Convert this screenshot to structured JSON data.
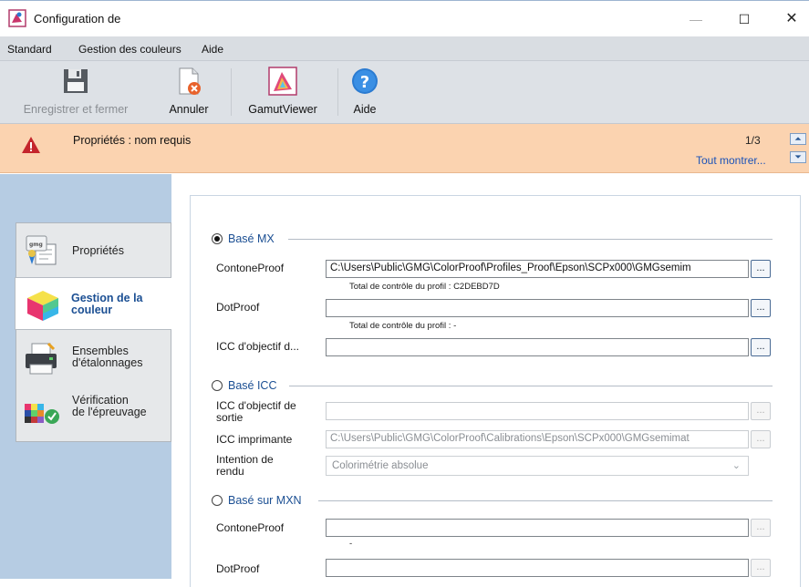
{
  "window": {
    "title": "Configuration de"
  },
  "menu": [
    "Standard",
    "Gestion des couleurs",
    "Aide"
  ],
  "toolbar": {
    "save_label": "Enregistrer et fermer",
    "cancel_label": "Annuler",
    "gamut_label": "GamutViewer",
    "help_label": "Aide"
  },
  "notification": {
    "message": "Propriétés : nom requis",
    "count": "1/3",
    "show_all": "Tout montrer..."
  },
  "nav": [
    {
      "label_l1": "Propriétés",
      "label_l2": "",
      "icon": "properties-icon"
    },
    {
      "label_l1": "Gestion de la",
      "label_l2": "couleur",
      "icon": "color-cube-icon"
    },
    {
      "label_l1": "Ensembles",
      "label_l2": "d'étalonnages",
      "icon": "printer-icon"
    },
    {
      "label_l1": "Vérification",
      "label_l2": "de l'épreuvage",
      "icon": "verification-icon"
    }
  ],
  "sections": {
    "mx": {
      "title": "Basé MX",
      "contone_label": "ContoneProof",
      "contone_value": "C:\\Users\\Public\\GMG\\ColorProof\\Profiles_Proof\\Epson\\SCPx000\\GMGsemim",
      "contone_checksum": "Total de contrôle du profil : C2DEBD7D",
      "dot_label": "DotProof",
      "dot_value": "",
      "dot_checksum": "Total de contrôle du profil : -",
      "icc_label": "ICC d'objectif d...",
      "icc_value": ""
    },
    "icc": {
      "title": "Basé ICC",
      "icc_out_label_l1": "ICC d'objectif de",
      "icc_out_label_l2": "sortie",
      "icc_out_value": "",
      "printer_label": "ICC imprimante",
      "printer_value": "C:\\Users\\Public\\GMG\\ColorProof\\Calibrations\\Epson\\SCPx000\\GMGsemimat",
      "intent_label_l1": "Intention de",
      "intent_label_l2": "rendu",
      "intent_value": "Colorimétrie absolue"
    },
    "mxn": {
      "title": "Basé sur MXN",
      "contone_label": "ContoneProof",
      "contone_value": "",
      "dash": "-",
      "dot_label": "DotProof",
      "dot_value": ""
    }
  },
  "browse_label": "...",
  "colors": {
    "link": "#1a52b8",
    "section": "#1b4f93",
    "notification_bg": "#fbd3b0",
    "sidebar_bg": "#b6cce3"
  }
}
